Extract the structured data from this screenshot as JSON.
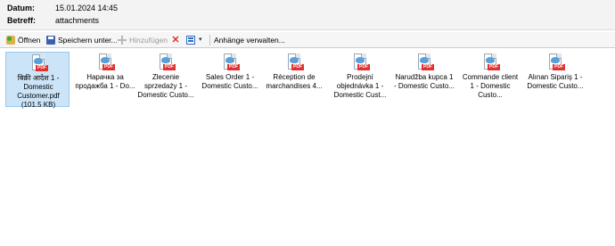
{
  "header": {
    "date_label": "Datum:",
    "date_value": "15.01.2024 14:45",
    "subject_label": "Betreff:",
    "subject_value": "attachments"
  },
  "toolbar": {
    "open_label": "Öffnen",
    "save_label": "Speichern unter...",
    "add_label": "Hinzufügen",
    "delete_icon": "red-x-icon",
    "view_icon": "view-mode-icon",
    "dropdown_glyph": "▾",
    "manage_label": "Anhänge verwalten..."
  },
  "attachments": [
    {
      "name": "बिक्री आदेश 1 - Domestic Customer.pdf (101.5 KB)",
      "selected": true
    },
    {
      "name": "Нарачка за продажба 1 - Do...",
      "selected": false
    },
    {
      "name": "Zlecenie sprzedaży 1 - Domestic Custo...",
      "selected": false
    },
    {
      "name": "Sales Order 1 - Domestic Custo...",
      "selected": false
    },
    {
      "name": "Réception de marchandises 4...",
      "selected": false
    },
    {
      "name": "Prodejní objednávka 1 - Domestic Cust...",
      "selected": false
    },
    {
      "name": "Narudžba kupca 1 - Domestic Custo...",
      "selected": false
    },
    {
      "name": "Commande client 1 - Domestic Custo...",
      "selected": false
    },
    {
      "name": "Alınan Sipariş 1 - Domestic Custo...",
      "selected": false
    }
  ],
  "file_badge": "PDF"
}
